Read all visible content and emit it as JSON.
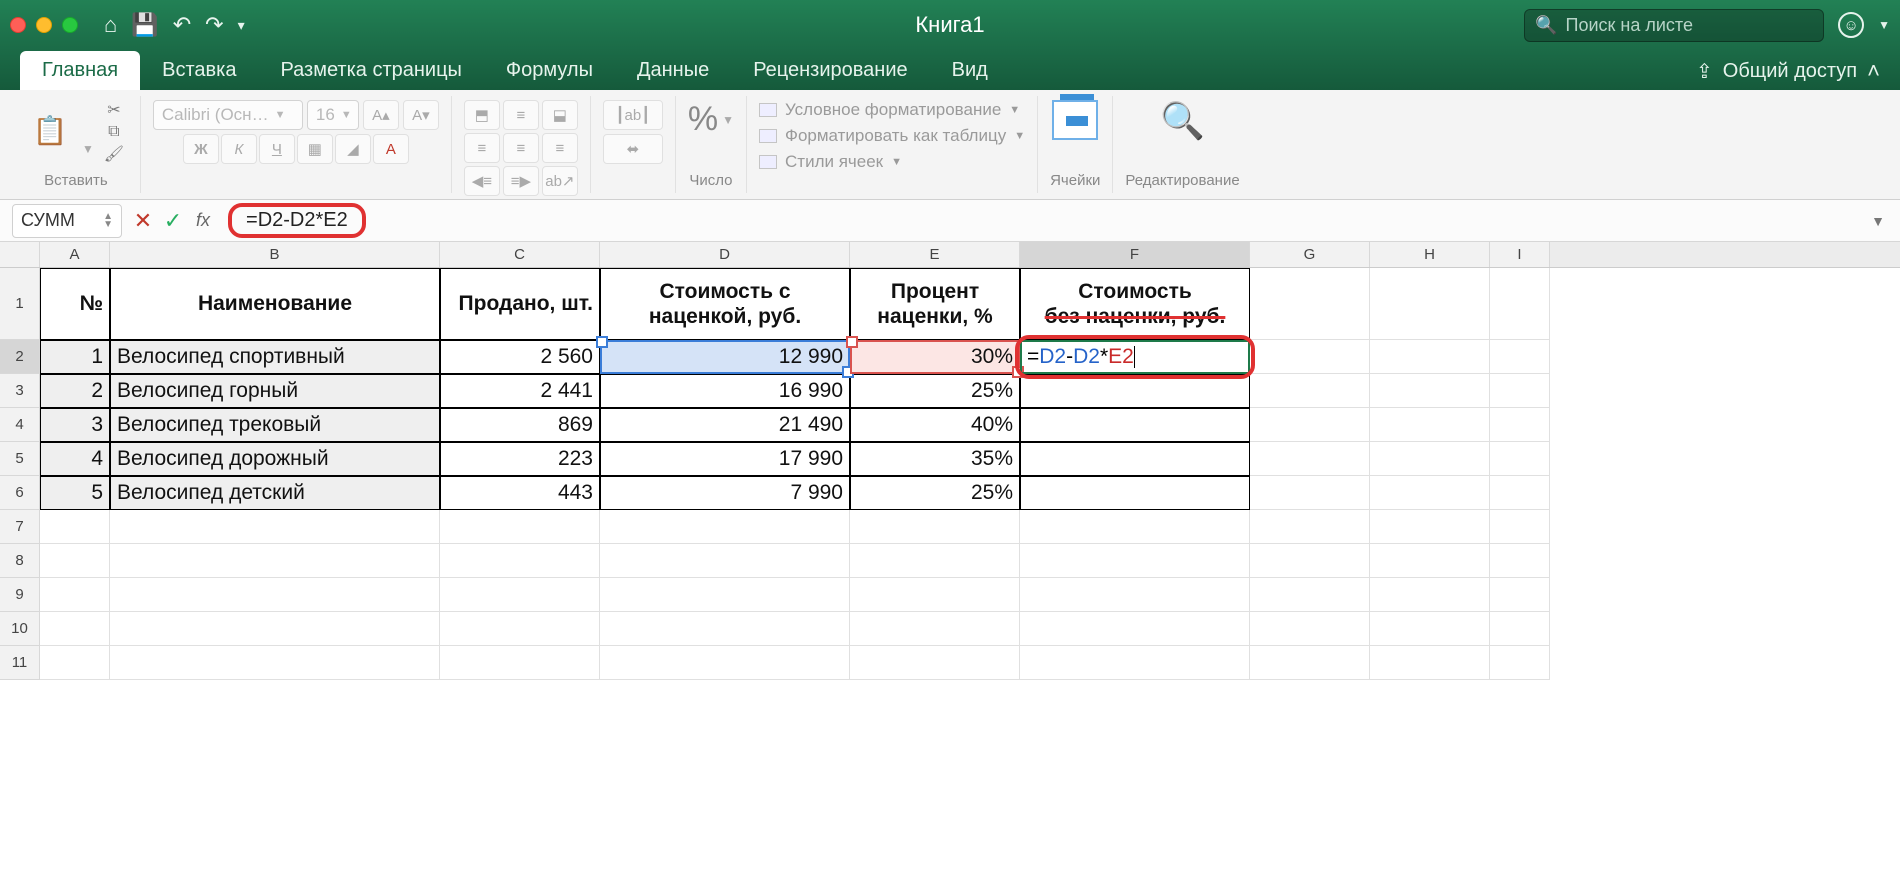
{
  "titlebar": {
    "doc_title": "Книга1",
    "search_placeholder": "Поиск на листе"
  },
  "tabs": {
    "items": [
      "Главная",
      "Вставка",
      "Разметка страницы",
      "Формулы",
      "Данные",
      "Рецензирование",
      "Вид"
    ],
    "share": "Общий доступ"
  },
  "ribbon": {
    "paste": "Вставить",
    "font_name": "Calibri (Осн…",
    "font_size": "16",
    "bold": "Ж",
    "italic": "К",
    "underline": "Ч",
    "number": "Число",
    "cond_format": "Условное форматирование",
    "format_table": "Форматировать как таблицу",
    "cell_styles": "Стили ячеек",
    "cells": "Ячейки",
    "editing": "Редактирование"
  },
  "formula_bar": {
    "name_box": "СУММ",
    "formula": "=D2-D2*E2"
  },
  "columns": [
    "A",
    "B",
    "C",
    "D",
    "E",
    "F",
    "G",
    "H",
    "I"
  ],
  "headers": {
    "A": "№",
    "B": "Наименование",
    "C": "Продано, шт.",
    "D": "Стоимость с наценкой, руб.",
    "E": "Процент наценки, %",
    "F": "Стоимость без наценки, руб."
  },
  "rows": [
    {
      "n": "1",
      "name": "Велосипед спортивный",
      "sold": "2 560",
      "cost": "12 990",
      "pct": "30%"
    },
    {
      "n": "2",
      "name": "Велосипед горный",
      "sold": "2 441",
      "cost": "16 990",
      "pct": "25%"
    },
    {
      "n": "3",
      "name": "Велосипед трековый",
      "sold": "869",
      "cost": "21 490",
      "pct": "40%"
    },
    {
      "n": "4",
      "name": "Велосипед дорожный",
      "sold": "223",
      "cost": "17 990",
      "pct": "35%"
    },
    {
      "n": "5",
      "name": "Велосипед детский",
      "sold": "443",
      "cost": "7 990",
      "pct": "25%"
    }
  ],
  "active_formula_parts": {
    "eq": "=",
    "d2": "D2",
    "minus": "-",
    "d2b": "D2",
    "star": "*",
    "e2": "E2"
  },
  "header_F_line1": "Стоимость",
  "header_F_line2": "без наценки, руб."
}
